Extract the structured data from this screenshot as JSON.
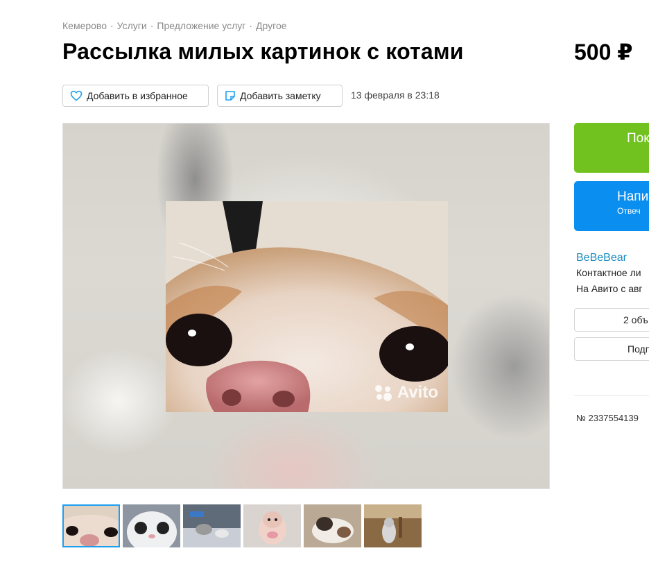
{
  "breadcrumb": [
    "Кемерово",
    "Услуги",
    "Предложение услуг",
    "Другое"
  ],
  "breadcrumb_separator": "·",
  "title": "Рассылка милых картинок с котами",
  "price": "500 ₽",
  "actions": {
    "favorite_label": "Добавить в избранное",
    "favorite_icon": "heart-icon",
    "note_label": "Добавить заметку",
    "note_icon": "note-icon",
    "date": "13 февраля в 23:18"
  },
  "gallery": {
    "watermark": "Avito",
    "thumbnail_count": 6,
    "active_thumbnail": 1
  },
  "contact": {
    "call_label": "Пок",
    "write_label": "Напи",
    "write_sublabel": "Отвеч"
  },
  "seller": {
    "name": "BeBeBear",
    "contact_person": "Контактное ли",
    "since": "На Авито с авг",
    "ads_button": "2 объ",
    "subscribe_button": "Подп"
  },
  "ad_number": "№ 2337554139",
  "colors": {
    "call_green": "#71c21e",
    "write_blue": "#0a8ff0",
    "seller_link": "#1a8cbe",
    "active_thumb_border": "#1e9ef0"
  }
}
